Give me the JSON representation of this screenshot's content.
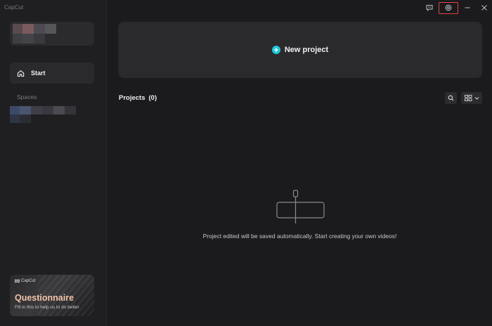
{
  "app": {
    "title": "CapCut"
  },
  "sidebar": {
    "start_label": "Start",
    "spaces_label": "Spaces"
  },
  "promo": {
    "brand": "CapCut",
    "title": "Questionnaire",
    "subtitle": "Fill in this to help us to do better"
  },
  "main": {
    "new_project_label": "New project",
    "projects_label": "Projects",
    "projects_count": "(0)",
    "empty_message": "Project edited will be saved automatically. Start creating your own videos!"
  },
  "colors": {
    "accent": "#1fc6d8",
    "promo_title": "#f2c4a8",
    "highlight": "#e0424c"
  },
  "icons": {
    "feedback": "feedback-icon",
    "settings": "settings-icon",
    "minimize": "minimize-icon",
    "close": "close-icon",
    "home": "home-icon",
    "search": "search-icon",
    "view": "grid-view-icon",
    "plus": "plus-icon"
  }
}
